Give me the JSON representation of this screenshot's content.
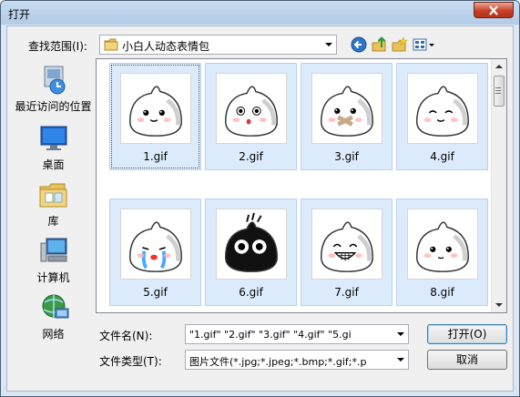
{
  "window": {
    "title": "打开"
  },
  "lookin": {
    "label": "查找范围(I):",
    "value": "小白人动态表情包"
  },
  "toolbar": {
    "back_icon": "back-arrow-icon",
    "up_icon": "up-folder-icon",
    "newfolder_icon": "new-folder-icon",
    "views_icon": "views-menu-icon"
  },
  "places": [
    {
      "label": "最近访问的位置",
      "icon": "recent-places-icon"
    },
    {
      "label": "桌面",
      "icon": "desktop-icon"
    },
    {
      "label": "库",
      "icon": "libraries-icon"
    },
    {
      "label": "计算机",
      "icon": "computer-icon"
    },
    {
      "label": "网络",
      "icon": "network-icon"
    }
  ],
  "files": [
    {
      "name": "1.gif",
      "face": "smile"
    },
    {
      "name": "2.gif",
      "face": "surprised"
    },
    {
      "name": "3.gif",
      "face": "taped"
    },
    {
      "name": "4.gif",
      "face": "content"
    },
    {
      "name": "5.gif",
      "face": "crying"
    },
    {
      "name": "6.gif",
      "face": "black"
    },
    {
      "name": "7.gif",
      "face": "grin"
    },
    {
      "name": "8.gif",
      "face": "calm"
    }
  ],
  "filename": {
    "label": "文件名(N):",
    "value": "\"1.gif\" \"2.gif\" \"3.gif\" \"4.gif\" \"5.gi"
  },
  "filetype": {
    "label": "文件类型(T):",
    "value": "图片文件(*.jpg;*.jpeg;*.bmp;*.gif;*.p"
  },
  "buttons": {
    "open": "打开(O)",
    "cancel": "取消"
  },
  "colors": {
    "selection": "#dcebfc",
    "titlebar": "#c9dcf1",
    "close": "#c7402a"
  }
}
